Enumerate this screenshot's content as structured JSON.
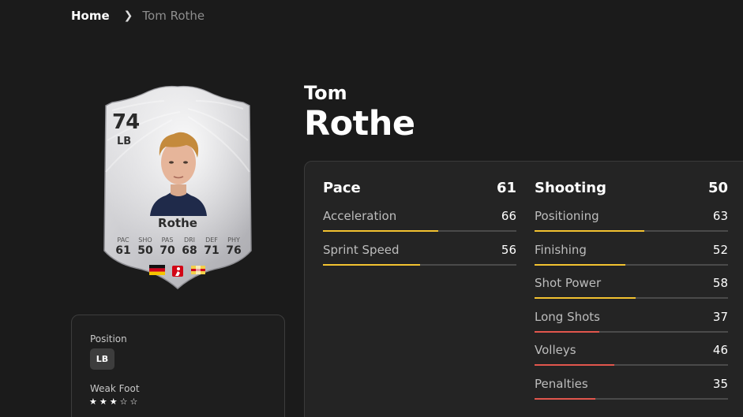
{
  "breadcrumb": {
    "home": "Home",
    "current": "Tom Rothe"
  },
  "card": {
    "rating": "74",
    "position": "LB",
    "name": "Rothe",
    "stats": [
      {
        "label": "PAC",
        "value": "61"
      },
      {
        "label": "SHO",
        "value": "50"
      },
      {
        "label": "PAS",
        "value": "70"
      },
      {
        "label": "DRI",
        "value": "68"
      },
      {
        "label": "DEF",
        "value": "71"
      },
      {
        "label": "PHY",
        "value": "76"
      }
    ],
    "badges": [
      "germany-flag-icon",
      "bundesliga-logo-icon",
      "union-berlin-crest-icon"
    ]
  },
  "info": {
    "position_label": "Position",
    "position_value": "LB",
    "weak_foot_label": "Weak Foot",
    "weak_foot_stars": 3,
    "weak_foot_max": 5
  },
  "player": {
    "first_name": "Tom",
    "last_name": "Rothe"
  },
  "stats": {
    "pace": {
      "title": "Pace",
      "value": "61",
      "items": [
        {
          "label": "Acceleration",
          "value": "66",
          "level": 66
        },
        {
          "label": "Sprint Speed",
          "value": "56",
          "level": 56
        }
      ]
    },
    "shooting": {
      "title": "Shooting",
      "value": "50",
      "items": [
        {
          "label": "Positioning",
          "value": "63",
          "level": 63
        },
        {
          "label": "Finishing",
          "value": "52",
          "level": 52
        },
        {
          "label": "Shot Power",
          "value": "58",
          "level": 58
        },
        {
          "label": "Long Shots",
          "value": "37",
          "level": 37
        },
        {
          "label": "Volleys",
          "value": "46",
          "level": 46
        },
        {
          "label": "Penalties",
          "value": "35",
          "level": 35
        }
      ]
    }
  },
  "colors": {
    "bar_yellow": "#f2c230",
    "bar_red": "#e2564d",
    "track": "#4a4a4a",
    "background": "#1b1b1b"
  }
}
